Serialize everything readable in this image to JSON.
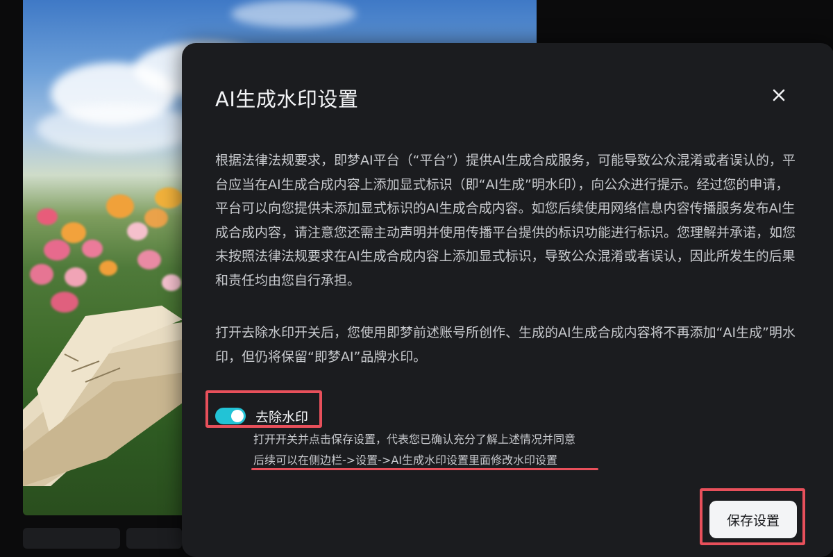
{
  "modal": {
    "title": "AI生成水印设置",
    "paragraph1": "根据法律法规要求，即梦AI平台（“平台”）提供AI生成合成服务，可能导致公众混淆或者误认的，平台应当在AI生成合成内容上添加显式标识（即“AI生成”明水印），向公众进行提示。经过您的申请，平台可以向您提供未添加显式标识的AI生成合成内容。如您后续使用网络信息内容传播服务发布AI生成合成内容，请注意您还需主动声明并使用传播平台提供的标识功能进行标识。您理解并承诺，如您未按照法律法规要求在AI生成合成内容上添加显式标识，导致公众混淆或者误认，因此所发生的后果和责任均由您自行承担。",
    "paragraph2": "打开去除水印开关后，您使用即梦前述账号所创作、生成的AI生成合成内容将不再添加“AI生成”明水印，但仍将保留“即梦AI”品牌水印。",
    "toggle": {
      "label": "去除水印",
      "on": true
    },
    "note_line1": "打开开关并点击保存设置，代表您已确认充分了解上述情况并同意",
    "note_line2": "后续可以在侧边栏->设置->AI生成水印设置里面修改水印设置",
    "save_label": "保存设置",
    "close_icon": "close-icon"
  },
  "colors": {
    "modal_bg": "#1b1c1f",
    "toggle_on": "#22c3d6",
    "annotation": "#e8505b"
  }
}
